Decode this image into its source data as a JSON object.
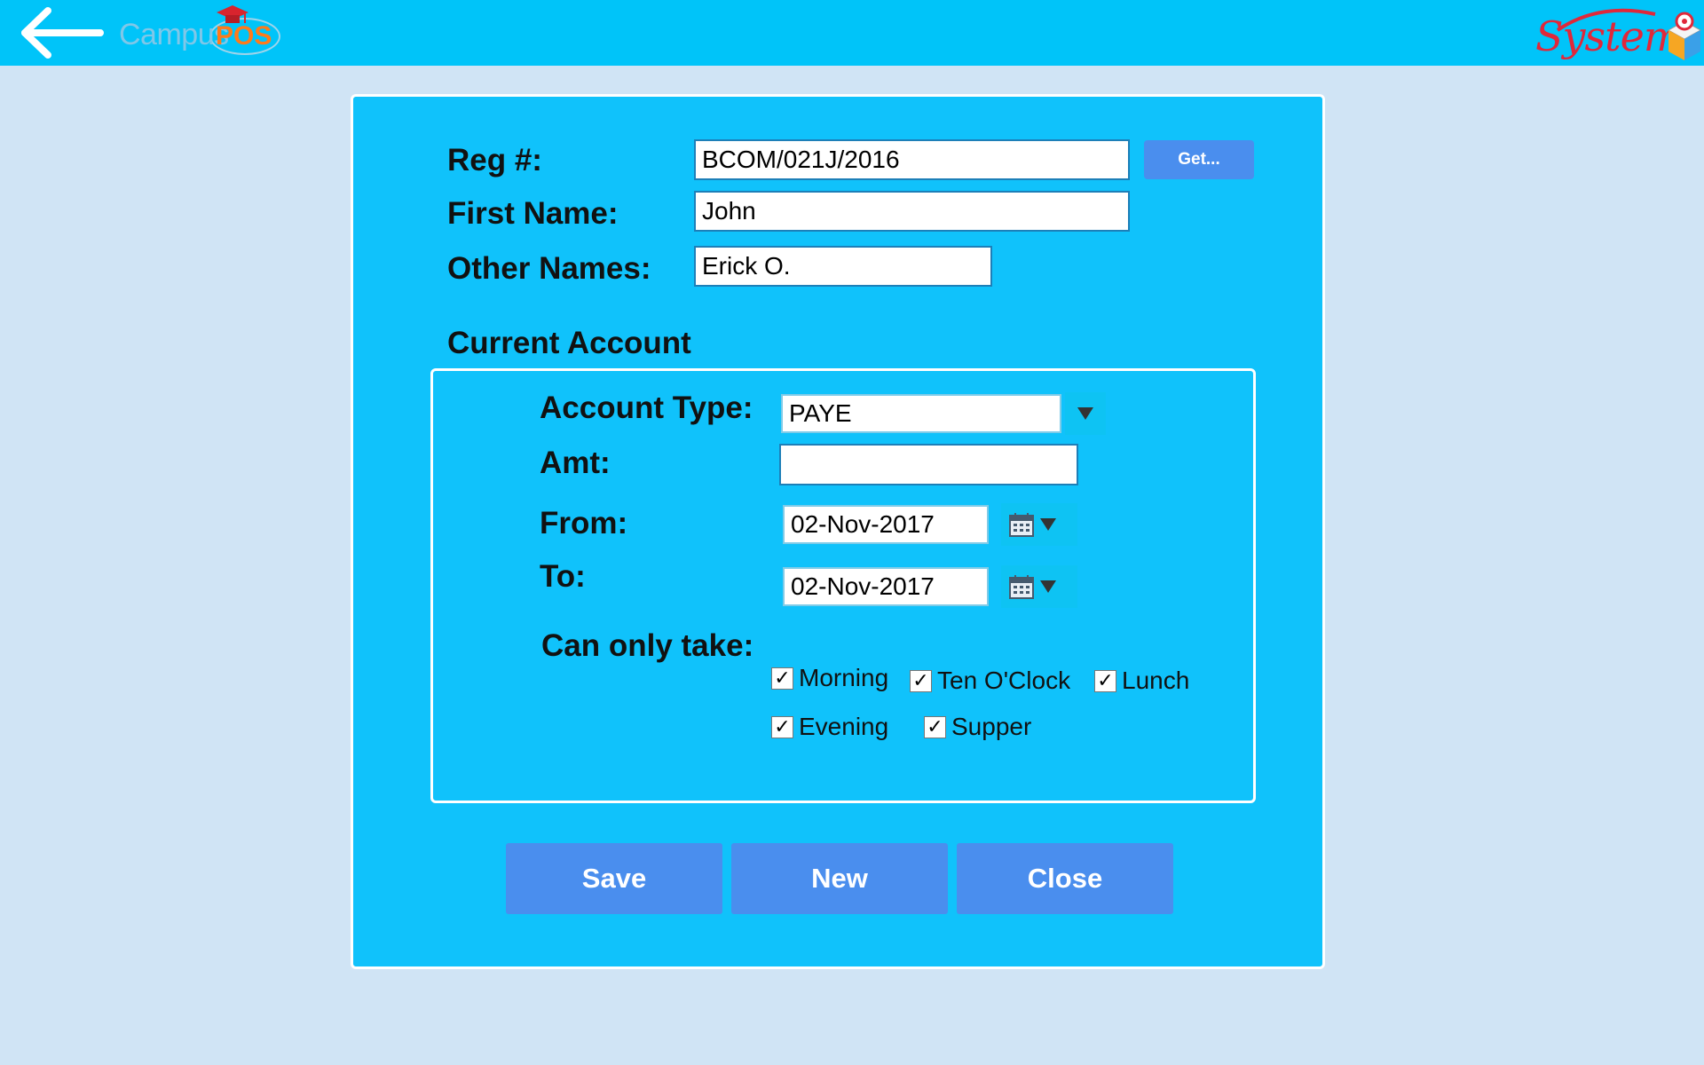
{
  "header": {
    "back_icon": "back-arrow-icon",
    "campus_logo_text": "Campus",
    "campus_logo_pos": "POS",
    "system_logo_text": "System",
    "colors": {
      "bar": "#00c4f9",
      "accent": "#e0283a"
    }
  },
  "form": {
    "reg_label": "Reg #:",
    "reg_value": "BCOM/021J/2016",
    "get_button": "Get...",
    "first_name_label": "First Name:",
    "first_name_value": "John",
    "other_names_label": "Other Names:",
    "other_names_value": "Erick O."
  },
  "account": {
    "section_title": "Current Account",
    "account_type_label": "Account Type:",
    "account_type_value": "PAYE",
    "amt_label": "Amt:",
    "amt_value": "",
    "from_label": "From:",
    "from_value": "02-Nov-2017",
    "to_label": "To:",
    "to_value": "02-Nov-2017",
    "can_only_take_label": "Can only take:",
    "meals": [
      {
        "label": "Morning",
        "checked": true
      },
      {
        "label": "Ten O'Clock",
        "checked": true
      },
      {
        "label": "Lunch",
        "checked": true
      },
      {
        "label": "Evening",
        "checked": true
      },
      {
        "label": "Supper",
        "checked": true
      }
    ]
  },
  "actions": {
    "save": "Save",
    "new": "New",
    "close": "Close"
  },
  "colors": {
    "background": "#d0e4f5",
    "card": "#10c2fb",
    "button": "#4a8eee"
  }
}
